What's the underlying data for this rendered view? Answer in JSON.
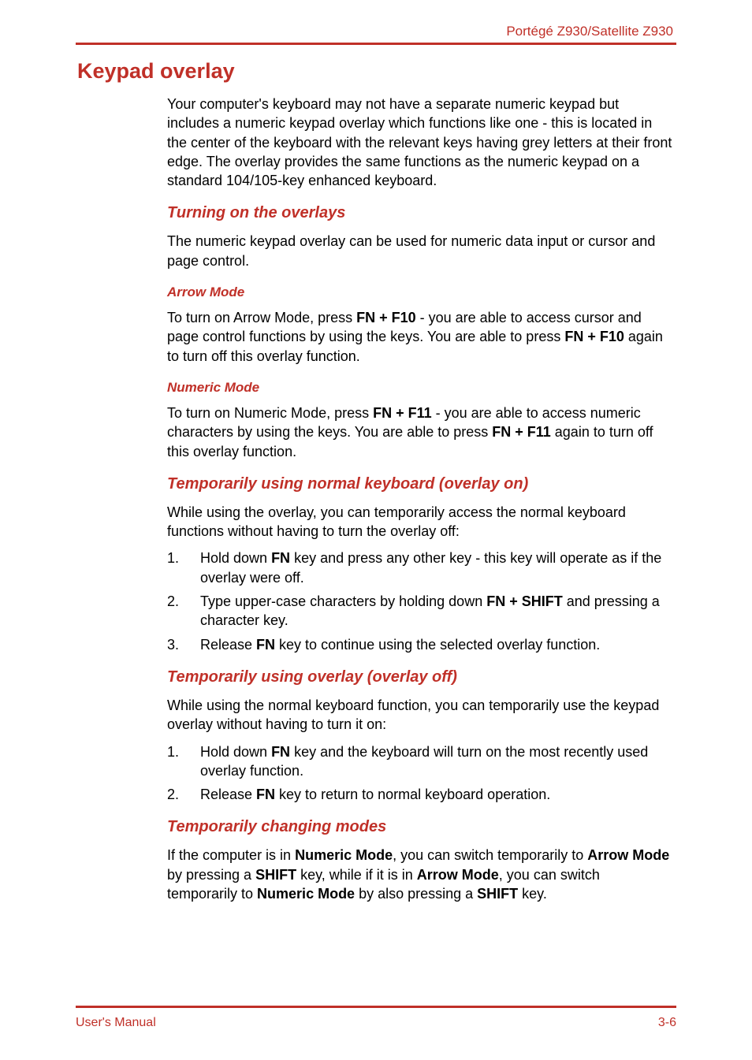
{
  "header": {
    "product": "Portégé Z930/Satellite Z930"
  },
  "h1": "Keypad overlay",
  "intro": "Your computer's keyboard may not have a separate numeric keypad but includes a numeric keypad overlay which functions like one - this is located in the center of the keyboard with the relevant keys having grey letters at their front edge. The overlay provides the same functions as the numeric keypad on a standard 104/105-key enhanced keyboard.",
  "s1": {
    "title": "Turning on the overlays",
    "para": "The numeric keypad overlay can be used for numeric data input or cursor and page control.",
    "arrow": {
      "title": "Arrow Mode",
      "p_pre": "To turn on Arrow Mode, press ",
      "p_k1": "FN + F10",
      "p_mid": " - you are able to access cursor and page control functions by using the keys. You are able to press ",
      "p_k2": "FN + F10",
      "p_post": " again to turn off this overlay function."
    },
    "numeric": {
      "title": "Numeric Mode",
      "p_pre": "To turn on Numeric Mode, press ",
      "p_k1": "FN + F11",
      "p_mid": " - you are able to access numeric characters by using the keys. You are able to press ",
      "p_k2": "FN + F11",
      "p_post": " again to turn off this overlay function."
    }
  },
  "s2": {
    "title": "Temporarily using normal keyboard (overlay on)",
    "para": "While using the overlay, you can temporarily access the normal keyboard functions without having to turn the overlay off:",
    "items": [
      {
        "n": "1.",
        "pre": "Hold down ",
        "b1": "FN",
        "mid": " key and press any other key - this key will operate as if the overlay were off.",
        "b2": "",
        "post": ""
      },
      {
        "n": "2.",
        "pre": "Type upper-case characters by holding down ",
        "b1": "FN + SHIFT",
        "mid": " and pressing a character key.",
        "b2": "",
        "post": ""
      },
      {
        "n": "3.",
        "pre": "Release ",
        "b1": "FN",
        "mid": " key to continue using the selected overlay function.",
        "b2": "",
        "post": ""
      }
    ]
  },
  "s3": {
    "title": "Temporarily using overlay (overlay off)",
    "para": "While using the normal keyboard function, you can temporarily use the keypad overlay without having to turn it on:",
    "items": [
      {
        "n": "1.",
        "pre": "Hold down ",
        "b1": "FN",
        "mid": " key and the keyboard will turn on the most recently used overlay function.",
        "b2": "",
        "post": ""
      },
      {
        "n": "2.",
        "pre": "Release ",
        "b1": "FN",
        "mid": " key to return to normal keyboard operation.",
        "b2": "",
        "post": ""
      }
    ]
  },
  "s4": {
    "title": "Temporarily changing modes",
    "p": {
      "t0": "If the computer is in ",
      "b0": "Numeric Mode",
      "t1": ", you can switch temporarily to ",
      "b1": "Arrow Mode",
      "t2": " by pressing a ",
      "b2": "SHIFT",
      "t3": " key, while if it is in ",
      "b3": "Arrow Mode",
      "t4": ", you can switch temporarily to ",
      "b4": "Numeric Mode",
      "t5": " by also pressing a ",
      "b5": "SHIFT",
      "t6": " key."
    }
  },
  "footer": {
    "left": "User's Manual",
    "right": "3-6"
  }
}
